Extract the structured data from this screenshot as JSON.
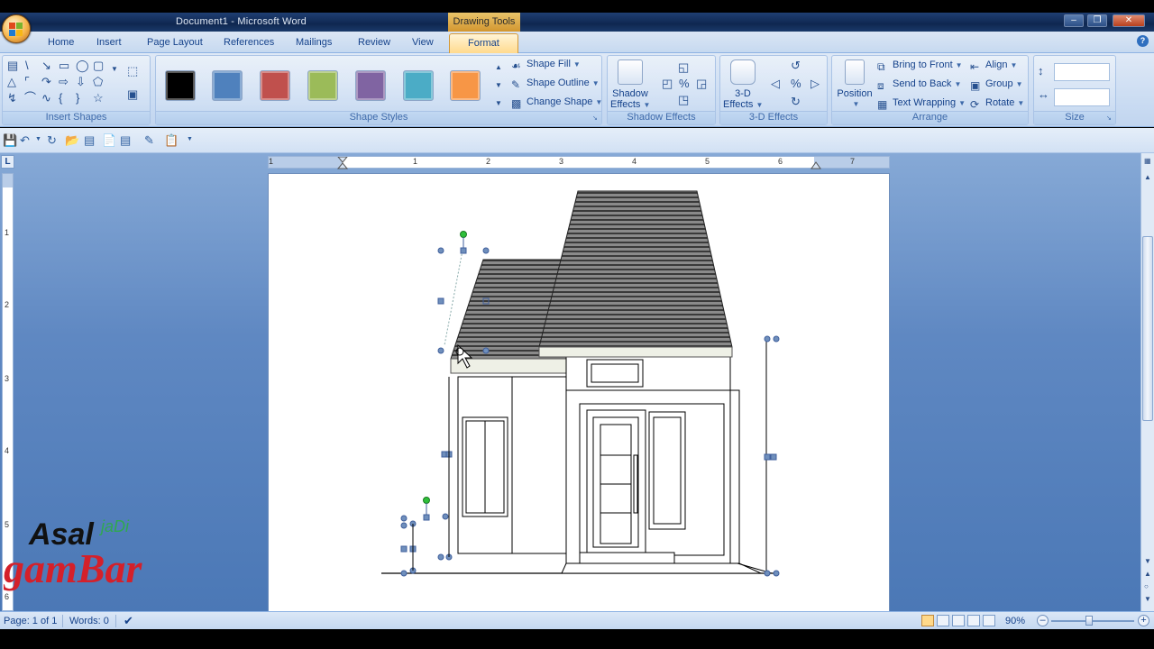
{
  "window": {
    "title": "Document1 - Microsoft Word",
    "contextual_tab": "Drawing Tools",
    "buttons": [
      "minimize",
      "restore",
      "close"
    ]
  },
  "tabs": [
    {
      "label": "Home"
    },
    {
      "label": "Insert"
    },
    {
      "label": "Page Layout"
    },
    {
      "label": "References"
    },
    {
      "label": "Mailings"
    },
    {
      "label": "Review"
    },
    {
      "label": "View"
    },
    {
      "label": "Format",
      "active": true
    }
  ],
  "ribbon": {
    "insert_shapes": {
      "label": "Insert Shapes"
    },
    "shape_styles": {
      "label": "Shape Styles",
      "swatches": [
        "#000000",
        "#4f81bd",
        "#c0504d",
        "#9bbb59",
        "#8064a2",
        "#4bacc6",
        "#f79646"
      ],
      "shape_fill": "Shape Fill",
      "shape_outline": "Shape Outline",
      "change_shape": "Change Shape"
    },
    "shadow_effects": {
      "label": "Shadow Effects",
      "button": "Shadow",
      "button2": "Effects"
    },
    "three_d_effects": {
      "label": "3-D Effects",
      "button": "3-D",
      "button2": "Effects"
    },
    "arrange": {
      "label": "Arrange",
      "position": "Position",
      "bring_to_front": "Bring to Front",
      "send_to_back": "Send to Back",
      "text_wrapping": "Text Wrapping",
      "align": "Align",
      "group": "Group",
      "rotate": "Rotate"
    },
    "size": {
      "label": "Size",
      "height": "",
      "width": ""
    }
  },
  "ruler": {
    "h_numbers": [
      "1",
      "1",
      "2",
      "3",
      "4",
      "5",
      "6",
      "7"
    ],
    "v_numbers": [
      "1",
      "2",
      "3",
      "4",
      "5",
      "6"
    ]
  },
  "status": {
    "page": "Page: 1 of 1",
    "words": "Words: 0",
    "zoom": "90%"
  },
  "watermark": {
    "line1": "Asal",
    "line1b": "jaDi",
    "line2": "gamBar"
  },
  "colors": {
    "accent": "#ffd98a",
    "ribbon": "#c9dbf2",
    "workspace": "#5f88c2"
  }
}
